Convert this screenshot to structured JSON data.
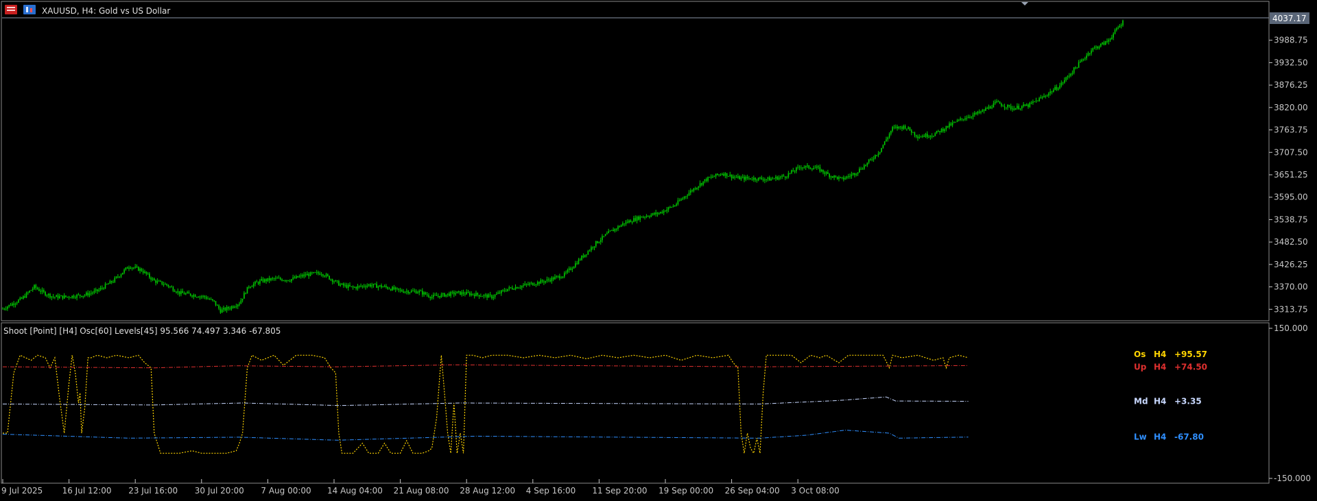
{
  "window": {
    "title": "XAUUSD, H4:  Gold vs US Dollar",
    "icons": [
      "symbol-window-icon",
      "chart-properties-icon"
    ]
  },
  "colors": {
    "background": "#000000",
    "candle": "#00d000",
    "axis": "#c8c8c8",
    "osc": "#ffd400",
    "up": "#e0302f",
    "md": "#c8d8ff",
    "lw": "#2f8fff",
    "label_os": "#ffd400",
    "label_up": "#e0302f",
    "label_md": "#c8d8ff",
    "label_lw": "#2f8fff"
  },
  "chart_data": [
    {
      "type": "candlestick",
      "symbol": "XAUUSD",
      "timeframe": "H4",
      "title": "XAUUSD, H4:  Gold vs US Dollar",
      "last_price": "4037.17",
      "ylim": [
        3285,
        4045
      ],
      "y_ticks": [
        "3988.75",
        "3932.50",
        "3876.25",
        "3820.00",
        "3763.75",
        "3707.50",
        "3651.25",
        "3595.00",
        "3538.75",
        "3482.50",
        "3426.25",
        "3370.00",
        "3313.75"
      ],
      "x_ticks": [
        "9 Jul 2025",
        "16 Jul 12:00",
        "23 Jul 16:00",
        "30 Jul 20:00",
        "7 Aug 00:00",
        "14 Aug 04:00",
        "21 Aug 08:00",
        "28 Aug 12:00",
        "4 Sep 16:00",
        "11 Sep 20:00",
        "19 Sep 00:00",
        "26 Sep 04:00",
        "3 Oct 08:00"
      ],
      "close_path": [
        [
          0,
          3315
        ],
        [
          12,
          3340
        ],
        [
          20,
          3370
        ],
        [
          26,
          3355
        ],
        [
          32,
          3345
        ],
        [
          40,
          3345
        ],
        [
          52,
          3350
        ],
        [
          60,
          3360
        ],
        [
          70,
          3385
        ],
        [
          80,
          3422
        ],
        [
          88,
          3412
        ],
        [
          96,
          3385
        ],
        [
          104,
          3375
        ],
        [
          112,
          3355
        ],
        [
          120,
          3350
        ],
        [
          128,
          3345
        ],
        [
          134,
          3332
        ],
        [
          138,
          3310
        ],
        [
          144,
          3318
        ],
        [
          150,
          3330
        ],
        [
          156,
          3372
        ],
        [
          164,
          3385
        ],
        [
          172,
          3390
        ],
        [
          182,
          3388
        ],
        [
          192,
          3400
        ],
        [
          202,
          3405
        ],
        [
          214,
          3375
        ],
        [
          222,
          3368
        ],
        [
          232,
          3375
        ],
        [
          242,
          3370
        ],
        [
          252,
          3360
        ],
        [
          264,
          3358
        ],
        [
          272,
          3345
        ],
        [
          280,
          3350
        ],
        [
          288,
          3355
        ],
        [
          298,
          3352
        ],
        [
          310,
          3345
        ],
        [
          320,
          3365
        ],
        [
          332,
          3375
        ],
        [
          344,
          3385
        ],
        [
          356,
          3400
        ],
        [
          366,
          3440
        ],
        [
          376,
          3480
        ],
        [
          384,
          3505
        ],
        [
          394,
          3530
        ],
        [
          404,
          3545
        ],
        [
          416,
          3555
        ],
        [
          426,
          3575
        ],
        [
          436,
          3610
        ],
        [
          446,
          3640
        ],
        [
          456,
          3655
        ],
        [
          466,
          3643
        ],
        [
          476,
          3642
        ],
        [
          486,
          3640
        ],
        [
          496,
          3648
        ],
        [
          506,
          3672
        ],
        [
          516,
          3668
        ],
        [
          524,
          3650
        ],
        [
          532,
          3640
        ],
        [
          540,
          3655
        ],
        [
          548,
          3680
        ],
        [
          556,
          3712
        ],
        [
          564,
          3768
        ],
        [
          572,
          3772
        ],
        [
          580,
          3748
        ],
        [
          590,
          3752
        ],
        [
          600,
          3775
        ],
        [
          610,
          3795
        ],
        [
          620,
          3808
        ],
        [
          630,
          3832
        ],
        [
          640,
          3818
        ],
        [
          650,
          3825
        ],
        [
          660,
          3848
        ],
        [
          670,
          3875
        ],
        [
          680,
          3920
        ],
        [
          690,
          3965
        ],
        [
          700,
          3985
        ],
        [
          710,
          4035
        ]
      ]
    },
    {
      "type": "line",
      "indicator": "Shoot [Point] [H4]  Osc[60]  Levels[45] 95.566 74.497 3.346 -67.805",
      "ylim": [
        -150,
        150
      ],
      "y_ticks": [
        "150.000",
        "-150.000"
      ],
      "series": [
        {
          "name": "Os",
          "label": {
            "name": "Os",
            "tf": "H4",
            "value": "+95.57"
          },
          "values": [
            [
              0,
              -60
            ],
            [
              3,
              -60
            ],
            [
              7,
              60
            ],
            [
              11,
              95
            ],
            [
              18,
              85
            ],
            [
              22,
              95
            ],
            [
              27,
              90
            ],
            [
              30,
              70
            ],
            [
              33,
              90
            ],
            [
              36,
              10
            ],
            [
              39,
              -60
            ],
            [
              42,
              40
            ],
            [
              44,
              95
            ],
            [
              46,
              60
            ],
            [
              48,
              0
            ],
            [
              49,
              20
            ],
            [
              50,
              -60
            ],
            [
              52,
              -10
            ],
            [
              54,
              90
            ],
            [
              56,
              90
            ],
            [
              60,
              95
            ],
            [
              66,
              90
            ],
            [
              72,
              95
            ],
            [
              80,
              90
            ],
            [
              86,
              95
            ],
            [
              90,
              80
            ],
            [
              94,
              70
            ],
            [
              96,
              -60
            ],
            [
              100,
              -100
            ],
            [
              106,
              -100
            ],
            [
              112,
              -100
            ],
            [
              120,
              -95
            ],
            [
              126,
              -100
            ],
            [
              134,
              -100
            ],
            [
              142,
              -100
            ],
            [
              148,
              -95
            ],
            [
              150,
              -80
            ],
            [
              152,
              -60
            ],
            [
              155,
              70
            ],
            [
              158,
              95
            ],
            [
              164,
              85
            ],
            [
              172,
              95
            ],
            [
              178,
              75
            ],
            [
              186,
              95
            ],
            [
              196,
              95
            ],
            [
              204,
              90
            ],
            [
              208,
              70
            ],
            [
              211,
              60
            ],
            [
              213,
              -60
            ],
            [
              215,
              -100
            ],
            [
              222,
              -100
            ],
            [
              228,
              -80
            ],
            [
              232,
              -100
            ],
            [
              238,
              -100
            ],
            [
              242,
              -80
            ],
            [
              246,
              -100
            ],
            [
              252,
              -100
            ],
            [
              256,
              -75
            ],
            [
              260,
              -100
            ],
            [
              266,
              -100
            ],
            [
              270,
              -95
            ],
            [
              272,
              -90
            ],
            [
              275,
              -30
            ],
            [
              278,
              95
            ],
            [
              280,
              20
            ],
            [
              282,
              -60
            ],
            [
              284,
              -100
            ],
            [
              286,
              0
            ],
            [
              288,
              -100
            ],
            [
              290,
              -60
            ],
            [
              292,
              -100
            ],
            [
              294,
              95
            ],
            [
              298,
              95
            ],
            [
              304,
              90
            ],
            [
              310,
              95
            ],
            [
              320,
              95
            ],
            [
              330,
              90
            ],
            [
              340,
              95
            ],
            [
              350,
              90
            ],
            [
              360,
              95
            ],
            [
              370,
              88
            ],
            [
              380,
              95
            ],
            [
              390,
              90
            ],
            [
              400,
              95
            ],
            [
              410,
              90
            ],
            [
              420,
              95
            ],
            [
              430,
              85
            ],
            [
              440,
              95
            ],
            [
              450,
              90
            ],
            [
              460,
              95
            ],
            [
              463,
              80
            ],
            [
              466,
              70
            ],
            [
              468,
              -60
            ],
            [
              470,
              -100
            ],
            [
              472,
              -60
            ],
            [
              474,
              -90
            ],
            [
              476,
              -100
            ],
            [
              478,
              -70
            ],
            [
              480,
              -100
            ],
            [
              482,
              20
            ],
            [
              484,
              95
            ],
            [
              490,
              95
            ],
            [
              500,
              95
            ],
            [
              506,
              80
            ],
            [
              512,
              95
            ],
            [
              518,
              90
            ],
            [
              522,
              95
            ],
            [
              530,
              80
            ],
            [
              536,
              95
            ],
            [
              548,
              95
            ],
            [
              558,
              95
            ],
            [
              562,
              70
            ],
            [
              564,
              95
            ],
            [
              570,
              90
            ],
            [
              580,
              95
            ],
            [
              590,
              85
            ],
            [
              596,
              90
            ],
            [
              598,
              70
            ],
            [
              600,
              90
            ],
            [
              606,
              95
            ],
            [
              612,
              90
            ]
          ]
        },
        {
          "name": "Up",
          "label": {
            "name": "Up",
            "tf": "H4",
            "value": "+74.50"
          },
          "values": [
            [
              0,
              72
            ],
            [
              96,
              70
            ],
            [
              148,
              74
            ],
            [
              212,
              72
            ],
            [
              286,
              76
            ],
            [
              480,
              72
            ],
            [
              612,
              74.5
            ]
          ]
        },
        {
          "name": "Md",
          "label": {
            "name": "Md",
            "tf": "H4",
            "value": "+3.35"
          },
          "values": [
            [
              0,
              -2
            ],
            [
              96,
              -4
            ],
            [
              152,
              0
            ],
            [
              214,
              -5
            ],
            [
              290,
              0
            ],
            [
              480,
              -2
            ],
            [
              530,
              5
            ],
            [
              560,
              12
            ],
            [
              566,
              4
            ],
            [
              612,
              3.35
            ]
          ]
        },
        {
          "name": "Lw",
          "label": {
            "name": "Lw",
            "tf": "H4",
            "value": "-67.80"
          },
          "values": [
            [
              0,
              -62
            ],
            [
              80,
              -70
            ],
            [
              150,
              -68
            ],
            [
              212,
              -74
            ],
            [
              300,
              -66
            ],
            [
              480,
              -70
            ],
            [
              510,
              -64
            ],
            [
              534,
              -54
            ],
            [
              562,
              -60
            ],
            [
              568,
              -70
            ],
            [
              612,
              -67.8
            ]
          ]
        }
      ]
    }
  ]
}
